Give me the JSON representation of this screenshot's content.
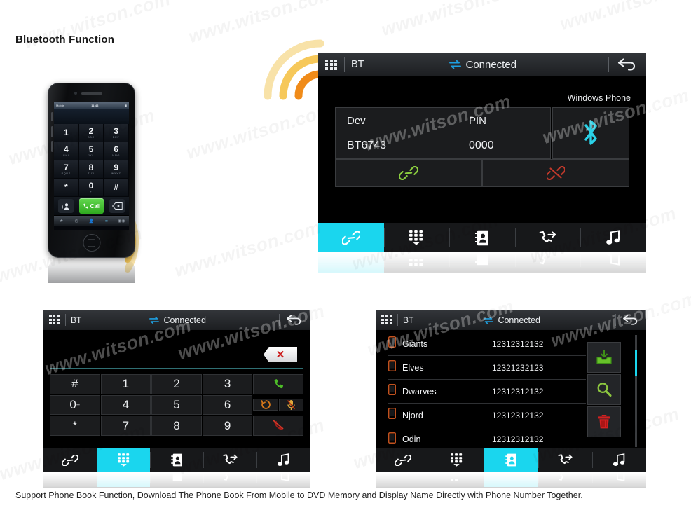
{
  "page": {
    "title": "Bluetooth Function",
    "footer_caption": "Support Phone Book Function, Download The Phone Book From Mobile to DVD Memory and Display Name Directly with Phone Number Together.",
    "watermark_text": "www.witson.com",
    "accent_color": "#1ad6ee",
    "bluetooth_color": "#2ad2e8",
    "background_color": "#ffffff"
  },
  "phone_mockup": {
    "status_bar": {
      "carrier": "Mobile",
      "time": "11:48",
      "battery": ""
    },
    "keys": [
      {
        "digit": "1",
        "letters": ""
      },
      {
        "digit": "2",
        "letters": "ABC"
      },
      {
        "digit": "3",
        "letters": "DEF"
      },
      {
        "digit": "4",
        "letters": "GHI"
      },
      {
        "digit": "5",
        "letters": "JKL"
      },
      {
        "digit": "6",
        "letters": "MNO"
      },
      {
        "digit": "7",
        "letters": "PQRS"
      },
      {
        "digit": "8",
        "letters": "TUV"
      },
      {
        "digit": "9",
        "letters": "WXYZ"
      },
      {
        "digit": "*",
        "letters": ""
      },
      {
        "digit": "0",
        "letters": "+"
      },
      {
        "digit": "#",
        "letters": ""
      }
    ],
    "call_button_label": "Call",
    "add_contact_icon": "add-contact-icon",
    "backspace_icon": "backspace-icon",
    "tabs": [
      {
        "label": "Favorites",
        "icon": "star-icon",
        "active": false
      },
      {
        "label": "Recents",
        "icon": "clock-icon",
        "active": false
      },
      {
        "label": "Contacts",
        "icon": "person-icon",
        "active": false
      },
      {
        "label": "Keypad",
        "icon": "keypad-icon",
        "active": true
      },
      {
        "label": "Voicemail",
        "icon": "voicemail-icon",
        "active": false
      }
    ]
  },
  "main_unit": {
    "topbar": {
      "menu_icon": "grid-menu-icon",
      "source_label": "BT",
      "status_icon": "transfer-arrows-icon",
      "status_text": "Connected",
      "back_icon": "back-arrow-icon"
    },
    "device_card": {
      "col_dev_header": "Dev",
      "col_pin_header": "PIN",
      "dev_value": "BT6743",
      "pin_value": "0000"
    },
    "device_actions": [
      {
        "name": "link-button",
        "icon": "link-icon",
        "color": "#7dc242"
      },
      {
        "name": "unlink-button",
        "icon": "broken-link-icon",
        "color": "#c0392b"
      }
    ],
    "paired_phone": {
      "caption": "Windows Phone",
      "icon": "bluetooth-icon"
    },
    "navbar": [
      {
        "name": "nav-pair",
        "icon": "link-icon",
        "active": true
      },
      {
        "name": "nav-keypad",
        "icon": "keypad-icon",
        "active": false
      },
      {
        "name": "nav-phonebook",
        "icon": "contact-card-icon",
        "active": false
      },
      {
        "name": "nav-calllog",
        "icon": "call-log-icon",
        "active": false
      },
      {
        "name": "nav-music",
        "icon": "music-note-icon",
        "active": false
      }
    ]
  },
  "dial_unit": {
    "topbar": {
      "menu_icon": "grid-menu-icon",
      "source_label": "BT",
      "status_icon": "transfer-arrows-icon",
      "status_text": "Connected",
      "back_icon": "back-arrow-icon"
    },
    "number_input": {
      "value": "",
      "placeholder": "",
      "backspace_icon": "backspace-delete-icon"
    },
    "keypad_rows": [
      [
        {
          "label": "#",
          "type": "key"
        },
        {
          "label": "1",
          "type": "key"
        },
        {
          "label": "2",
          "type": "key"
        },
        {
          "label": "3",
          "type": "key"
        },
        {
          "label": "",
          "type": "call",
          "icon": "green-call-icon"
        }
      ],
      [
        {
          "label": "0",
          "sup": "+",
          "type": "key"
        },
        {
          "label": "4",
          "type": "key"
        },
        {
          "label": "5",
          "type": "key"
        },
        {
          "label": "6",
          "type": "key"
        },
        {
          "label": "",
          "type": "split",
          "icons": [
            "transfer-call-icon",
            "mute-mic-icon"
          ]
        }
      ],
      [
        {
          "label": "*",
          "type": "key"
        },
        {
          "label": "7",
          "type": "key"
        },
        {
          "label": "8",
          "type": "key"
        },
        {
          "label": "9",
          "type": "key"
        },
        {
          "label": "",
          "type": "endcall",
          "icon": "red-end-call-icon"
        }
      ]
    ],
    "navbar": [
      {
        "name": "nav-pair",
        "icon": "link-icon",
        "active": false
      },
      {
        "name": "nav-keypad",
        "icon": "keypad-icon",
        "active": true
      },
      {
        "name": "nav-phonebook",
        "icon": "contact-card-icon",
        "active": false
      },
      {
        "name": "nav-calllog",
        "icon": "call-log-icon",
        "active": false
      },
      {
        "name": "nav-music",
        "icon": "music-note-icon",
        "active": false
      }
    ]
  },
  "phonebook_unit": {
    "topbar": {
      "menu_icon": "grid-menu-icon",
      "source_label": "BT",
      "status_icon": "transfer-arrows-icon",
      "status_text": "Connected",
      "back_icon": "back-arrow-icon"
    },
    "contacts": [
      {
        "name": "Giants",
        "number": "12312312132",
        "icon": "mobile-phone-icon"
      },
      {
        "name": "Elves",
        "number": "12321232123",
        "icon": "mobile-phone-icon"
      },
      {
        "name": "Dwarves",
        "number": "12312312132",
        "icon": "mobile-phone-icon"
      },
      {
        "name": "Njord",
        "number": "12312312132",
        "icon": "mobile-phone-icon"
      },
      {
        "name": "Odin",
        "number": "12312312132",
        "icon": "mobile-phone-icon"
      }
    ],
    "side_actions": [
      {
        "name": "download-phonebook-button",
        "icon": "download-inbox-icon",
        "color": "#67c12a"
      },
      {
        "name": "search-contact-button",
        "icon": "magnifier-icon",
        "color": "#8cc63f"
      },
      {
        "name": "delete-contact-button",
        "icon": "trash-icon",
        "color": "#d32020"
      }
    ],
    "navbar": [
      {
        "name": "nav-pair",
        "icon": "link-icon",
        "active": false
      },
      {
        "name": "nav-keypad",
        "icon": "keypad-icon",
        "active": false
      },
      {
        "name": "nav-phonebook",
        "icon": "contact-card-icon",
        "active": true
      },
      {
        "name": "nav-calllog",
        "icon": "call-log-icon",
        "active": false
      },
      {
        "name": "nav-music",
        "icon": "music-note-icon",
        "active": false
      }
    ]
  }
}
